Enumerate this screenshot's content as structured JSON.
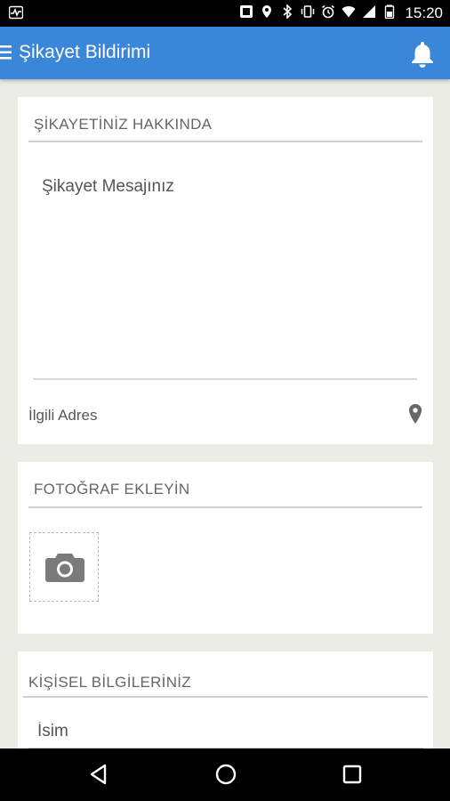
{
  "status_bar": {
    "time": "15:20",
    "icons": [
      "activity-icon",
      "nfc-icon",
      "location-icon",
      "bluetooth-icon",
      "vibrate-icon",
      "alarm-icon",
      "wifi-icon",
      "signal-icon",
      "battery-icon"
    ]
  },
  "app_bar": {
    "title": "Şikayet Bildirimi",
    "color": "#3a86d8"
  },
  "about_section": {
    "title": "ŞİKAYETİNİZ HAKKINDA",
    "message_placeholder": "Şikayet Mesajınız",
    "address_label": "İlgili Adres"
  },
  "photo_section": {
    "title": "FOTOĞRAF EKLEYİN"
  },
  "personal_section": {
    "title": "KİŞİSEL BİLGİLERİNİZ",
    "name_placeholder": "İsim"
  }
}
